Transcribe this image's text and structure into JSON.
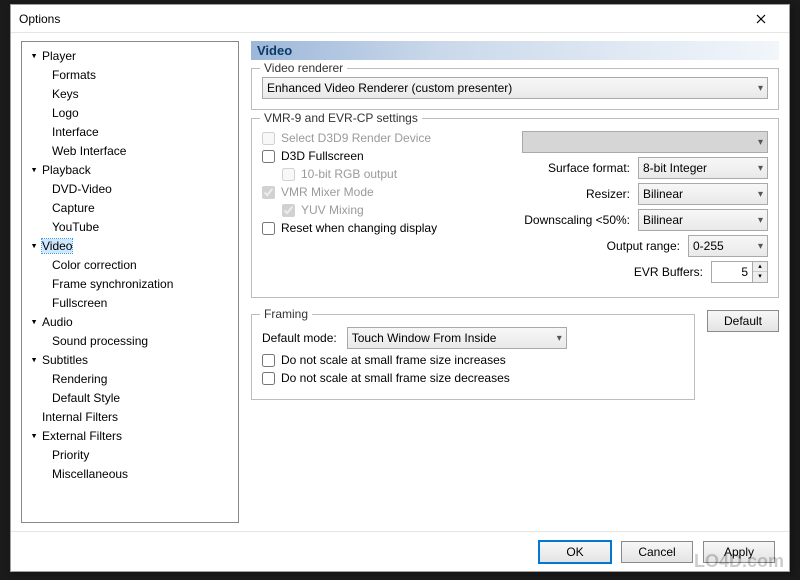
{
  "window": {
    "title": "Options"
  },
  "tree": {
    "player": {
      "label": "Player"
    },
    "formats": {
      "label": "Formats"
    },
    "keys": {
      "label": "Keys"
    },
    "logo": {
      "label": "Logo"
    },
    "interface": {
      "label": "Interface"
    },
    "webinterface": {
      "label": "Web Interface"
    },
    "playback": {
      "label": "Playback"
    },
    "dvdvideo": {
      "label": "DVD-Video"
    },
    "capture": {
      "label": "Capture"
    },
    "youtube": {
      "label": "YouTube"
    },
    "video": {
      "label": "Video"
    },
    "colorcorr": {
      "label": "Color correction"
    },
    "framesync": {
      "label": "Frame synchronization"
    },
    "fullscreen": {
      "label": "Fullscreen"
    },
    "audio": {
      "label": "Audio"
    },
    "soundproc": {
      "label": "Sound processing"
    },
    "subtitles": {
      "label": "Subtitles"
    },
    "rendering": {
      "label": "Rendering"
    },
    "defaultstyle": {
      "label": "Default Style"
    },
    "internalfilters": {
      "label": "Internal Filters"
    },
    "externalfilters": {
      "label": "External Filters"
    },
    "priority": {
      "label": "Priority"
    },
    "misc": {
      "label": "Miscellaneous"
    }
  },
  "video": {
    "title": "Video",
    "renderer_group": "Video renderer",
    "renderer_value": "Enhanced Video Renderer (custom presenter)",
    "vmr_group": "VMR-9 and EVR-CP settings",
    "select_d3d9": "Select D3D9 Render Device",
    "d3d_fullscreen": "D3D Fullscreen",
    "tenbit_rgb": "10-bit RGB output",
    "vmr_mixer": "VMR Mixer Mode",
    "yuv_mixing": "YUV Mixing",
    "reset_display": "Reset when changing display",
    "surface_format_label": "Surface format:",
    "surface_format_value": "8-bit Integer",
    "resizer_label": "Resizer:",
    "resizer_value": "Bilinear",
    "downscale_label": "Downscaling <50%:",
    "downscale_value": "Bilinear",
    "output_range_label": "Output range:",
    "output_range_value": "0-255",
    "evr_buffers_label": "EVR Buffers:",
    "evr_buffers_value": "5",
    "framing_group": "Framing",
    "default_mode_label": "Default mode:",
    "default_mode_value": "Touch Window From Inside",
    "no_scale_inc": "Do not scale at small frame size increases",
    "no_scale_dec": "Do not scale at small frame size decreases",
    "default_button": "Default"
  },
  "footer": {
    "ok": "OK",
    "cancel": "Cancel",
    "apply": "Apply"
  },
  "watermark": "LO4D.com"
}
